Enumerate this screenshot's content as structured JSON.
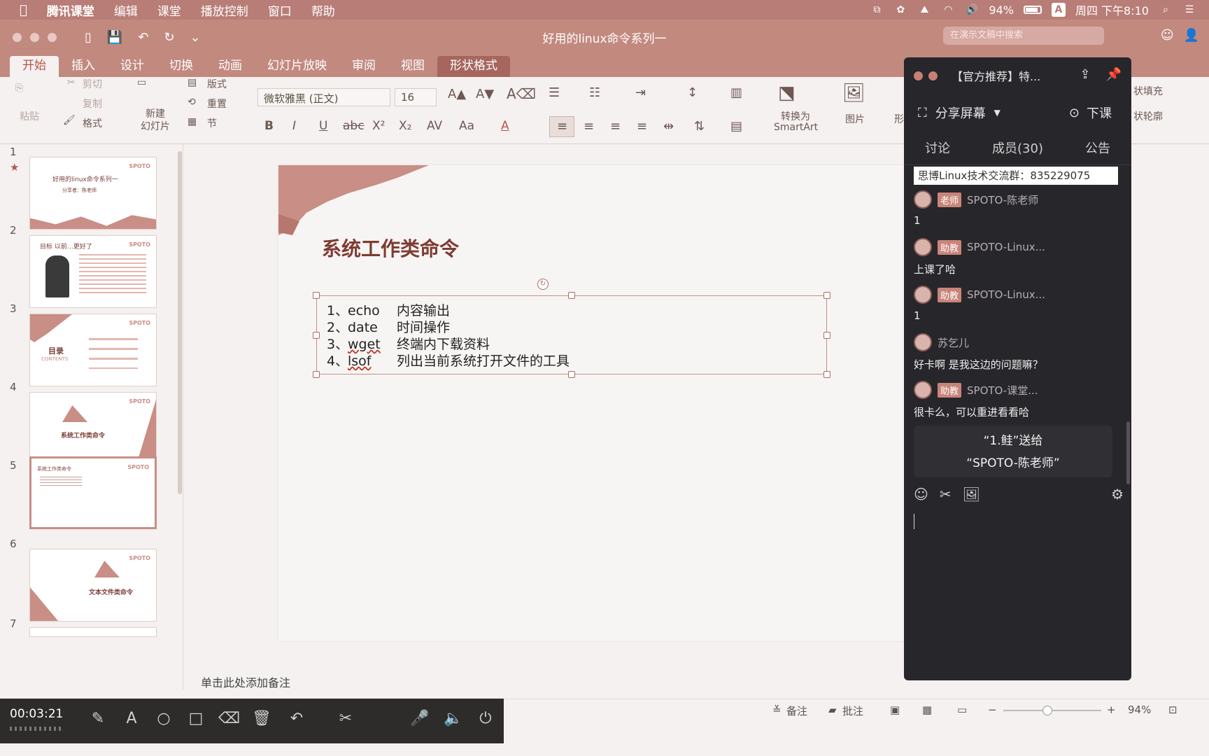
{
  "menubar": {
    "app": "腾讯课堂",
    "items": [
      "编辑",
      "课堂",
      "播放控制",
      "窗口",
      "帮助"
    ],
    "battery": "94%",
    "input_method": "A",
    "clock": "周四 下午8:10"
  },
  "window": {
    "title": "好用的linux命令系列一",
    "search_placeholder": "在演示文稿中搜索"
  },
  "ribbon_tabs": [
    "开始",
    "插入",
    "设计",
    "切换",
    "动画",
    "幻灯片放映",
    "审阅",
    "视图",
    "形状格式"
  ],
  "ribbon": {
    "paste": "粘贴",
    "cut": "剪切",
    "copy": "复制",
    "format_painter": "格式",
    "new_slide": "新建\n幻灯片",
    "layout": "版式",
    "reset": "重置",
    "section": "节",
    "font_name": "微软雅黑 (正文)",
    "font_size": "16",
    "convert_smartart_1": "转换为",
    "convert_smartart_2": "SmartArt",
    "picture": "图片",
    "shape_partial": "形",
    "fill_partial": "状填充",
    "outline_partial": "状轮廓",
    "format_buttons": [
      "B",
      "I",
      "U",
      "abc",
      "X²",
      "X₂",
      "AV",
      "Aa",
      "A"
    ]
  },
  "thumbnails": [
    {
      "num": "1",
      "title": "好用的linux命令系列一",
      "sub": "分享者：陈老师",
      "brand": "SPOTO"
    },
    {
      "num": "2",
      "title": "目标 以前…更好了",
      "sub": "",
      "brand": "SPOTO"
    },
    {
      "num": "3",
      "title": "目录",
      "sub": "CONTENTS",
      "brand": "SPOTO"
    },
    {
      "num": "4",
      "title": "系统工作类命令",
      "sub": "",
      "brand": "SPOTO"
    },
    {
      "num": "5",
      "title": "系统工作类命令",
      "sub": "",
      "brand": "SPOTO"
    },
    {
      "num": "6",
      "title": "文本文件类命令",
      "sub": "",
      "brand": "SPOTO"
    },
    {
      "num": "7",
      "title": "",
      "sub": "",
      "brand": ""
    }
  ],
  "slide": {
    "title": "系统工作类命令",
    "rows": [
      {
        "num": "1、",
        "cmd": "echo",
        "desc": "内容输出"
      },
      {
        "num": "2、",
        "cmd": "date",
        "desc": "时间操作"
      },
      {
        "num": "3、",
        "cmd": "wget",
        "desc": "终端内下载资料"
      },
      {
        "num": "4、",
        "cmd": "lsof",
        "desc": "列出当前系统打开文件的工具"
      }
    ]
  },
  "notes_placeholder": "单击此处添加备注",
  "statusbar": {
    "notes": "备注",
    "comments": "批注",
    "zoom": "94%"
  },
  "recorder": {
    "time": "00:03:21"
  },
  "chat": {
    "course": "【官方推荐】特...",
    "share_screen": "分享屏幕",
    "end_class": "下课",
    "tabs": [
      "讨论",
      "成员(30)",
      "公告"
    ],
    "notice": "思博Linux技术交流群：835229075",
    "messages": [
      {
        "role": "老师",
        "name": "SPOTO-陈老师",
        "text": "1"
      },
      {
        "role": "助教",
        "name": "SPOTO-Linux...",
        "text": "上课了哈"
      },
      {
        "role": "助教",
        "name": "SPOTO-Linux...",
        "text": "1"
      },
      {
        "role": "",
        "name": "苏乞儿",
        "text": "好卡啊  是我这边的问题嘛？"
      },
      {
        "role": "助教",
        "name": "SPOTO-课堂...",
        "text": "很卡么，可以重进看看哈"
      }
    ],
    "gift_line1": "“1.鲑”送给",
    "gift_line2": "“SPOTO-陈老师”"
  },
  "colors": {
    "accent": "#c2897f",
    "tab_active_text": "#b5574c",
    "chat_bg": "#27262a",
    "role_badge": "#c9847a"
  }
}
